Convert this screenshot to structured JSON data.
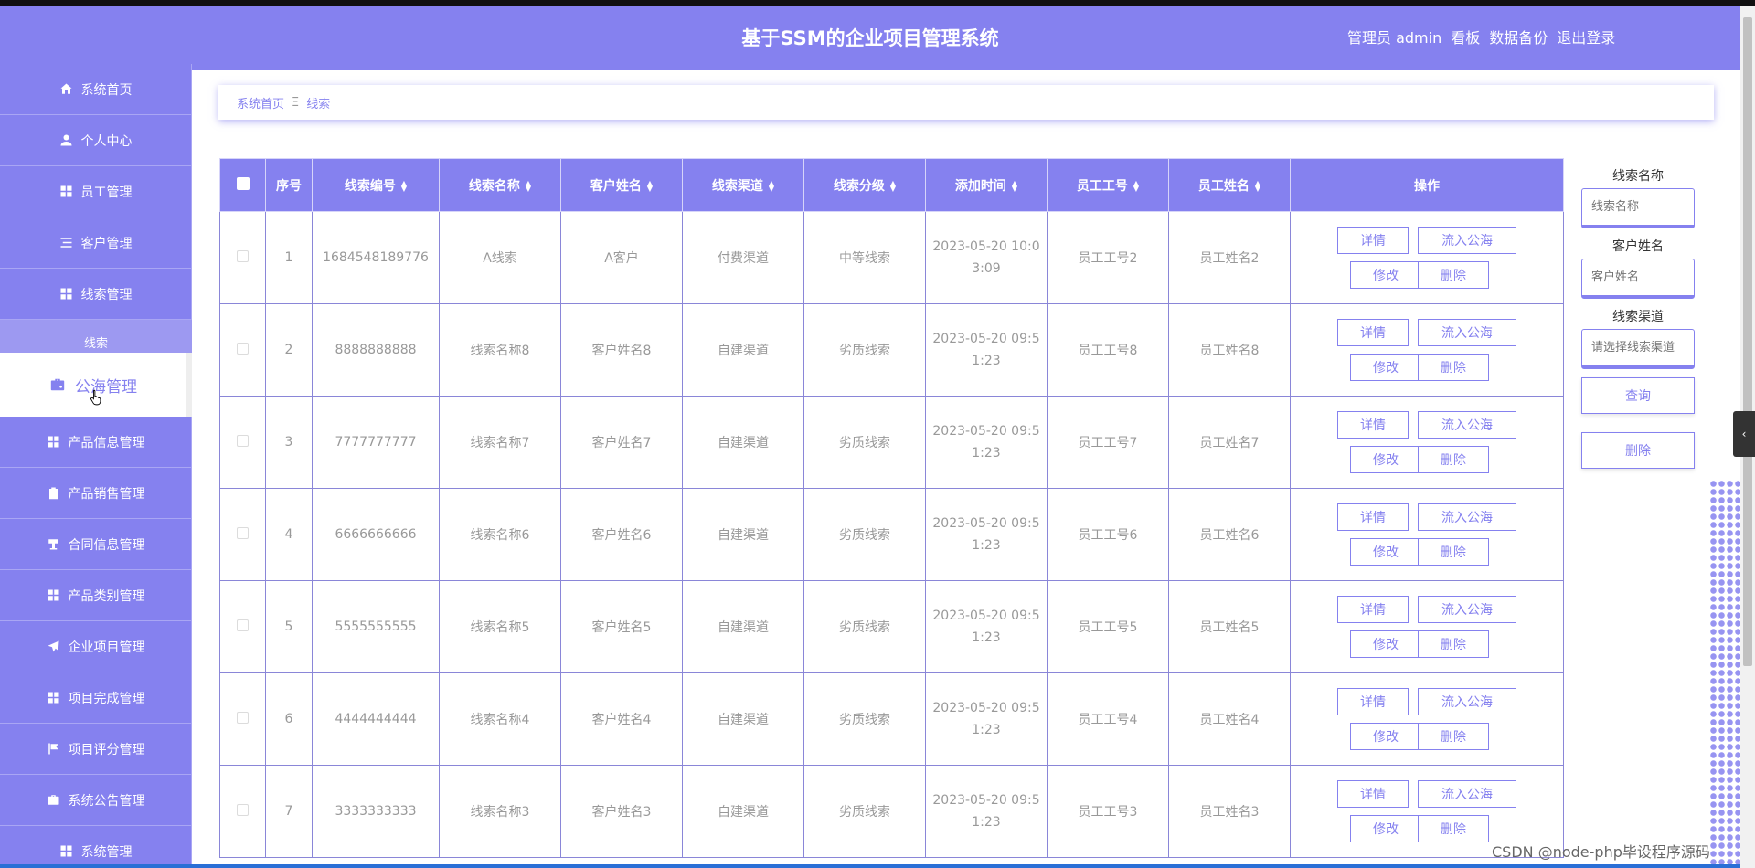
{
  "header": {
    "title": "基于SSM的企业项目管理系统",
    "admin_label": "管理员 admin",
    "nav": [
      "看板",
      "数据备份",
      "退出登录"
    ]
  },
  "sidebar": {
    "items_top": [
      {
        "label": "系统首页",
        "icon": "home-icon"
      },
      {
        "label": "个人中心",
        "icon": "user-icon"
      },
      {
        "label": "员工管理",
        "icon": "grid-icon"
      },
      {
        "label": "客户管理",
        "icon": "list-icon"
      },
      {
        "label": "线索管理",
        "icon": "grid-icon"
      }
    ],
    "submenu_head": "线索",
    "active_item": {
      "label": "公海管理",
      "icon": "briefcase-icon"
    },
    "items_bottom": [
      {
        "label": "产品信息管理",
        "icon": "grid-icon"
      },
      {
        "label": "产品销售管理",
        "icon": "clipboard-icon"
      },
      {
        "label": "合同信息管理",
        "icon": "cup-icon"
      },
      {
        "label": "产品类别管理",
        "icon": "grid-icon"
      },
      {
        "label": "企业项目管理",
        "icon": "send-icon"
      },
      {
        "label": "项目完成管理",
        "icon": "grid-icon"
      },
      {
        "label": "项目评分管理",
        "icon": "flag-icon"
      },
      {
        "label": "系统公告管理",
        "icon": "briefcase-icon"
      },
      {
        "label": "系统管理",
        "icon": "grid-icon"
      }
    ]
  },
  "breadcrumb": {
    "home": "系统首页",
    "separator": "Ξ",
    "current": "线索"
  },
  "table": {
    "headers": [
      "序号",
      "线索编号",
      "线索名称",
      "客户姓名",
      "线索渠道",
      "线索分级",
      "添加时间",
      "员工工号",
      "员工姓名",
      "操作"
    ],
    "actions": {
      "detail": "详情",
      "to_pool": "流入公海",
      "edit": "修改",
      "delete": "删除"
    },
    "rows": [
      {
        "no": "1",
        "code": "1684548189776",
        "name": "A线索",
        "customer": "A客户",
        "channel": "付费渠道",
        "level": "中等线索",
        "time": "2023-05-20 10:03:09",
        "emp_no": "员工工号2",
        "emp_name": "员工姓名2"
      },
      {
        "no": "2",
        "code": "8888888888",
        "name": "线索名称8",
        "customer": "客户姓名8",
        "channel": "自建渠道",
        "level": "劣质线索",
        "time": "2023-05-20 09:51:23",
        "emp_no": "员工工号8",
        "emp_name": "员工姓名8"
      },
      {
        "no": "3",
        "code": "7777777777",
        "name": "线索名称7",
        "customer": "客户姓名7",
        "channel": "自建渠道",
        "level": "劣质线索",
        "time": "2023-05-20 09:51:23",
        "emp_no": "员工工号7",
        "emp_name": "员工姓名7"
      },
      {
        "no": "4",
        "code": "6666666666",
        "name": "线索名称6",
        "customer": "客户姓名6",
        "channel": "自建渠道",
        "level": "劣质线索",
        "time": "2023-05-20 09:51:23",
        "emp_no": "员工工号6",
        "emp_name": "员工姓名6"
      },
      {
        "no": "5",
        "code": "5555555555",
        "name": "线索名称5",
        "customer": "客户姓名5",
        "channel": "自建渠道",
        "level": "劣质线索",
        "time": "2023-05-20 09:51:23",
        "emp_no": "员工工号5",
        "emp_name": "员工姓名5"
      },
      {
        "no": "6",
        "code": "4444444444",
        "name": "线索名称4",
        "customer": "客户姓名4",
        "channel": "自建渠道",
        "level": "劣质线索",
        "time": "2023-05-20 09:51:23",
        "emp_no": "员工工号4",
        "emp_name": "员工姓名4"
      },
      {
        "no": "7",
        "code": "3333333333",
        "name": "线索名称3",
        "customer": "客户姓名3",
        "channel": "自建渠道",
        "level": "劣质线索",
        "time": "2023-05-20 09:51:23",
        "emp_no": "员工工号3",
        "emp_name": "员工姓名3"
      }
    ]
  },
  "search": {
    "name_label": "线索名称",
    "name_placeholder": "线索名称",
    "customer_label": "客户姓名",
    "customer_placeholder": "客户姓名",
    "channel_label": "线索渠道",
    "channel_placeholder": "请选择线索渠道",
    "query_button": "查询",
    "delete_button": "删除"
  },
  "side_tab_icon": "chevron-left-icon",
  "watermark": "CSDN @node-php毕设程序源码",
  "colors": {
    "primary": "#8581ef",
    "text_muted": "#999999"
  }
}
